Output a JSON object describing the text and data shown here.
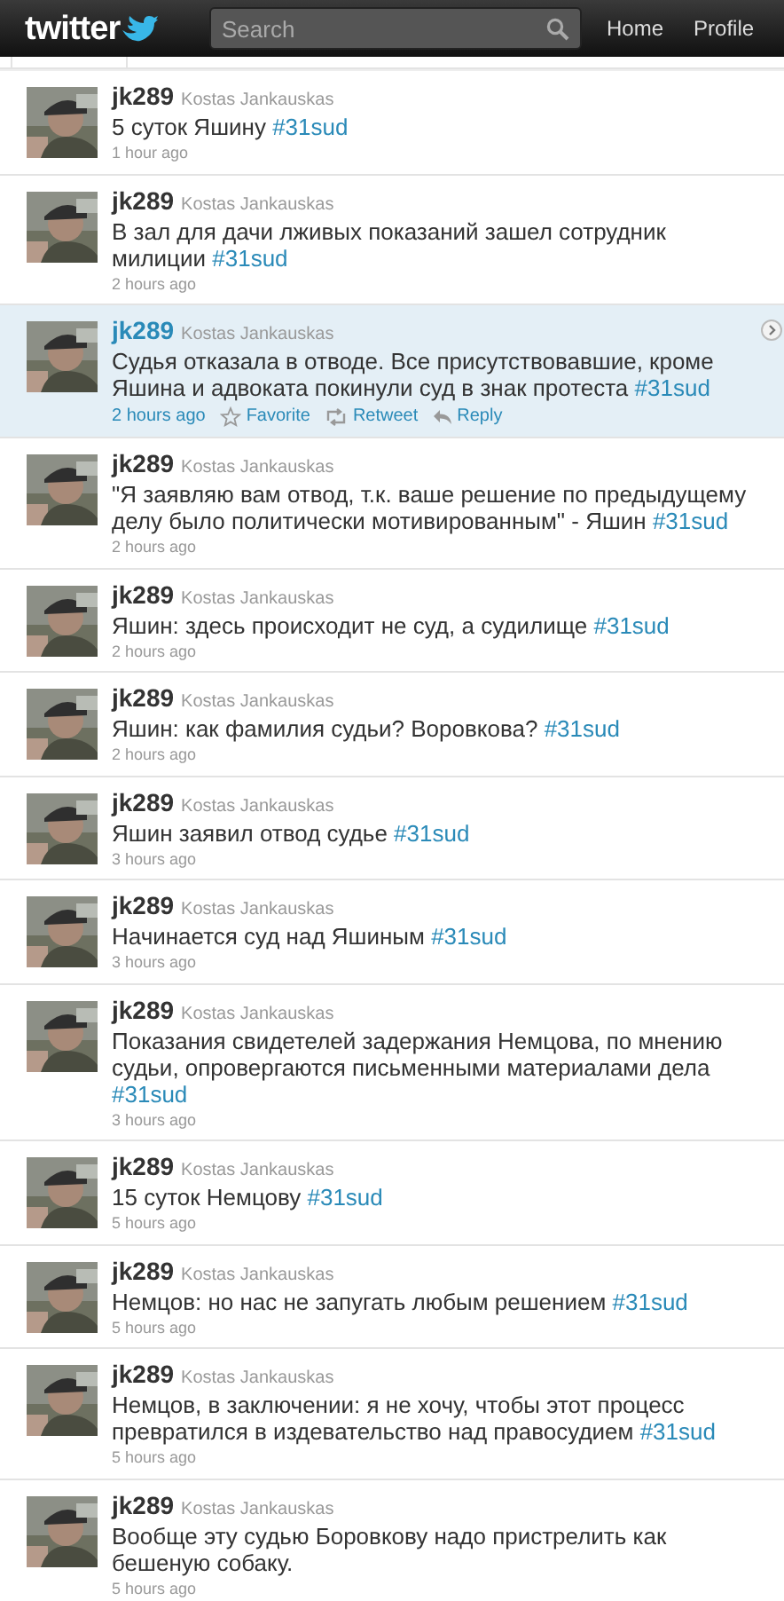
{
  "header": {
    "logo": "twitter",
    "search": {
      "placeholder": "Search"
    },
    "nav": [
      "Home",
      "Profile"
    ]
  },
  "tweets": [
    {
      "username": "jk289",
      "full_name": "Kostas Jankauskas",
      "text": "5 суток Яшину ",
      "hashtag": "#31sud",
      "time": "1 hour ago",
      "selected": false
    },
    {
      "username": "jk289",
      "full_name": "Kostas Jankauskas",
      "text": "В зал для дачи лживых показаний зашел сотрудник милиции ",
      "hashtag": "#31sud",
      "time": "2 hours ago",
      "selected": false
    },
    {
      "username": "jk289",
      "full_name": "Kostas Jankauskas",
      "text": "Судья отказала в отводе. Все присутствовавшие, кроме Яшина и адвоката покинули суд в знак протеста ",
      "hashtag": "#31sud",
      "time": "2 hours ago",
      "selected": true,
      "actions": [
        "Favorite",
        "Retweet",
        "Reply"
      ]
    },
    {
      "username": "jk289",
      "full_name": "Kostas Jankauskas",
      "text": "\"Я заявляю вам отвод, т.к. ваше решение по предыдущему делу было политически мотивированным\" - Яшин ",
      "hashtag": "#31sud",
      "time": "2 hours ago",
      "selected": false
    },
    {
      "username": "jk289",
      "full_name": "Kostas Jankauskas",
      "text": "Яшин: здесь происходит не суд, а судилище ",
      "hashtag": "#31sud",
      "time": "2 hours ago",
      "selected": false
    },
    {
      "username": "jk289",
      "full_name": "Kostas Jankauskas",
      "text": "Яшин: как фамилия судьи? Воровкова? ",
      "hashtag": "#31sud",
      "time": "2 hours ago",
      "selected": false
    },
    {
      "username": "jk289",
      "full_name": "Kostas Jankauskas",
      "text": "Яшин заявил отвод судье ",
      "hashtag": "#31sud",
      "time": "3 hours ago",
      "selected": false
    },
    {
      "username": "jk289",
      "full_name": "Kostas Jankauskas",
      "text": "Начинается суд над Яшиным ",
      "hashtag": "#31sud",
      "time": "3 hours ago",
      "selected": false
    },
    {
      "username": "jk289",
      "full_name": "Kostas Jankauskas",
      "text": "Показания свидетелей задержания Немцова, по мнению судьи, опровергаются письменными материалами дела ",
      "hashtag": "#31sud",
      "time": "3 hours ago",
      "selected": false
    },
    {
      "username": "jk289",
      "full_name": "Kostas Jankauskas",
      "text": "15 суток Немцову ",
      "hashtag": "#31sud",
      "time": "5 hours ago",
      "selected": false
    },
    {
      "username": "jk289",
      "full_name": "Kostas Jankauskas",
      "text": "Немцов: но нас не запугать любым решением ",
      "hashtag": "#31sud",
      "time": "5 hours ago",
      "selected": false
    },
    {
      "username": "jk289",
      "full_name": "Kostas Jankauskas",
      "text": "Немцов, в заключении: я не хочу, чтобы этот процесс превратился в издевательство над правосудием ",
      "hashtag": "#31sud",
      "time": "5 hours ago",
      "selected": false
    },
    {
      "username": "jk289",
      "full_name": "Kostas Jankauskas",
      "text": "Вообще эту судью Боровкову надо пристрелить как бешеную собаку.",
      "time": "5 hours ago",
      "selected": false
    }
  ]
}
